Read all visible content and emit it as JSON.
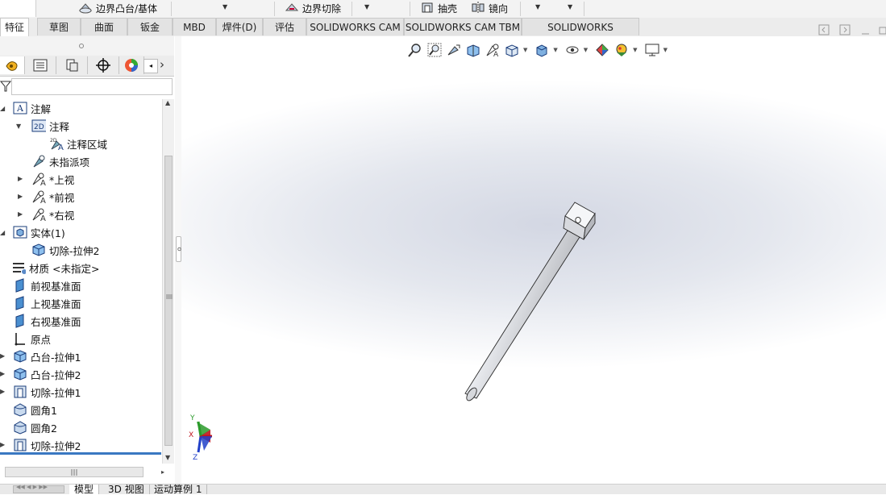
{
  "command_bar": {
    "boundary_boss_label": "边界凸台/基体",
    "boundary_cut_label": "边界切除",
    "shell_label": "抽壳",
    "mirror_label": "镜向"
  },
  "tabs": [
    {
      "label": "特征",
      "active": true
    },
    {
      "label": "草图"
    },
    {
      "label": "曲面"
    },
    {
      "label": "钣金"
    },
    {
      "label": "MBD"
    },
    {
      "label": "焊件(D)"
    },
    {
      "label": "评估"
    },
    {
      "label": "SOLIDWORKS CAM"
    },
    {
      "label": "SOLIDWORKS CAM TBM"
    },
    {
      "label": "SOLIDWORKS Inspection"
    }
  ],
  "feature_tree": {
    "items": [
      {
        "label": "注解",
        "icon": "annotation-icon"
      },
      {
        "label": "注释",
        "icon": "note-2d-icon"
      },
      {
        "label": "注释区域",
        "icon": "annotation-area-icon"
      },
      {
        "label": "未指派项",
        "icon": "unassigned-icon"
      },
      {
        "label": "*上视",
        "icon": "view-icon"
      },
      {
        "label": "*前视",
        "icon": "view-icon"
      },
      {
        "label": "*右视",
        "icon": "view-icon"
      },
      {
        "label": "实体(1)",
        "icon": "solid-bodies-icon"
      },
      {
        "label": "切除-拉伸2",
        "icon": "body-icon"
      },
      {
        "label": "材质 <未指定>",
        "icon": "material-icon"
      },
      {
        "label": "前视基准面",
        "icon": "plane-icon"
      },
      {
        "label": "上视基准面",
        "icon": "plane-icon"
      },
      {
        "label": "右视基准面",
        "icon": "plane-icon"
      },
      {
        "label": "原点",
        "icon": "origin-icon"
      },
      {
        "label": "凸台-拉伸1",
        "icon": "boss-extrude-icon"
      },
      {
        "label": "凸台-拉伸2",
        "icon": "boss-extrude-icon"
      },
      {
        "label": "切除-拉伸1",
        "icon": "cut-extrude-icon"
      },
      {
        "label": "圆角1",
        "icon": "fillet-icon"
      },
      {
        "label": "圆角2",
        "icon": "fillet-icon"
      },
      {
        "label": "切除-拉伸2",
        "icon": "cut-extrude-icon"
      }
    ]
  },
  "triad": {
    "x": "X",
    "y": "Y",
    "z": "Z"
  },
  "bottom_tabs": [
    {
      "label": "模型"
    },
    {
      "label": "3D 视图"
    },
    {
      "label": "运动算例 1"
    }
  ],
  "colors": {
    "accent": "#3a78c2",
    "x_axis": "#c0141e",
    "y_axis": "#2a9a2a",
    "z_axis": "#2140c8"
  }
}
